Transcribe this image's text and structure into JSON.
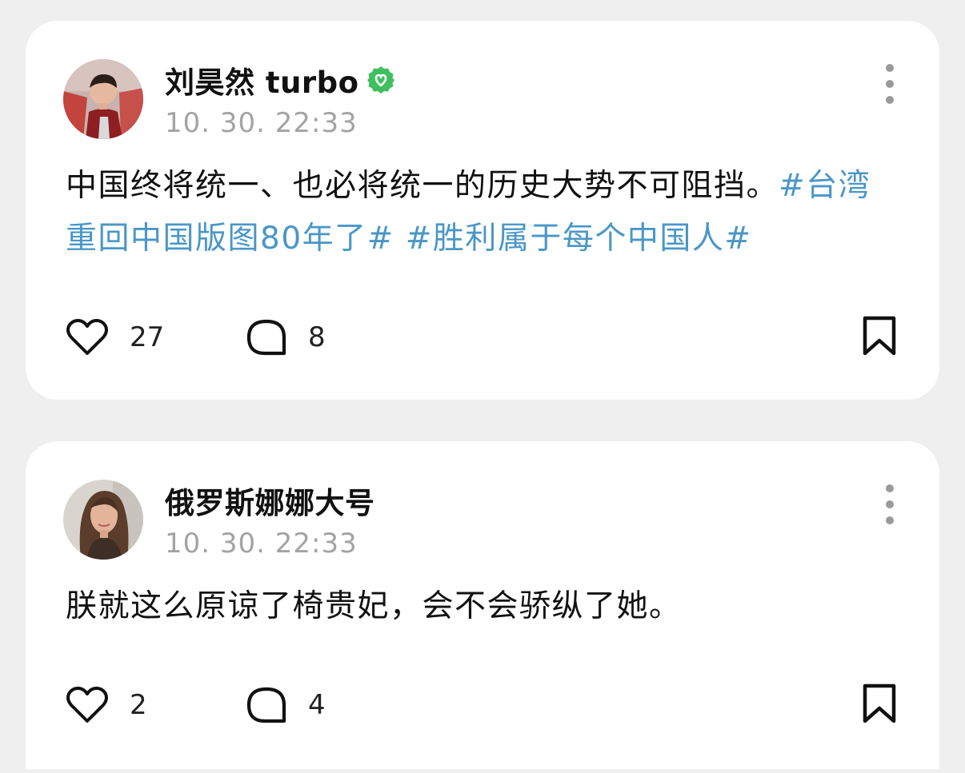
{
  "posts": [
    {
      "author": "刘昊然 turbo",
      "verified": true,
      "timestamp": "10. 30. 22:33",
      "text_plain": "中国终将统一、也必将统一的历史大势不可阻挡。",
      "hashtags": [
        "#台湾重回中国版图80年了#",
        "#胜利属于每个中国人#"
      ],
      "likes": "27",
      "comments": "8"
    },
    {
      "author": "俄罗斯娜娜大号",
      "verified": false,
      "timestamp": "10. 30. 22:33",
      "text_plain": "朕就这么原谅了椅贵妃，会不会骄纵了她。",
      "hashtags": [],
      "likes": "2",
      "comments": "4"
    }
  ],
  "icons": {
    "like": "heart-icon",
    "comment": "comment-bubble-icon",
    "bookmark": "bookmark-icon",
    "more": "more-vertical-icon",
    "verified": "verified-badge-icon"
  },
  "colors": {
    "hashtag": "#4a97c7",
    "verified": "#3fbf5f",
    "timestamp": "#a3a3a3",
    "background": "#efefef"
  }
}
